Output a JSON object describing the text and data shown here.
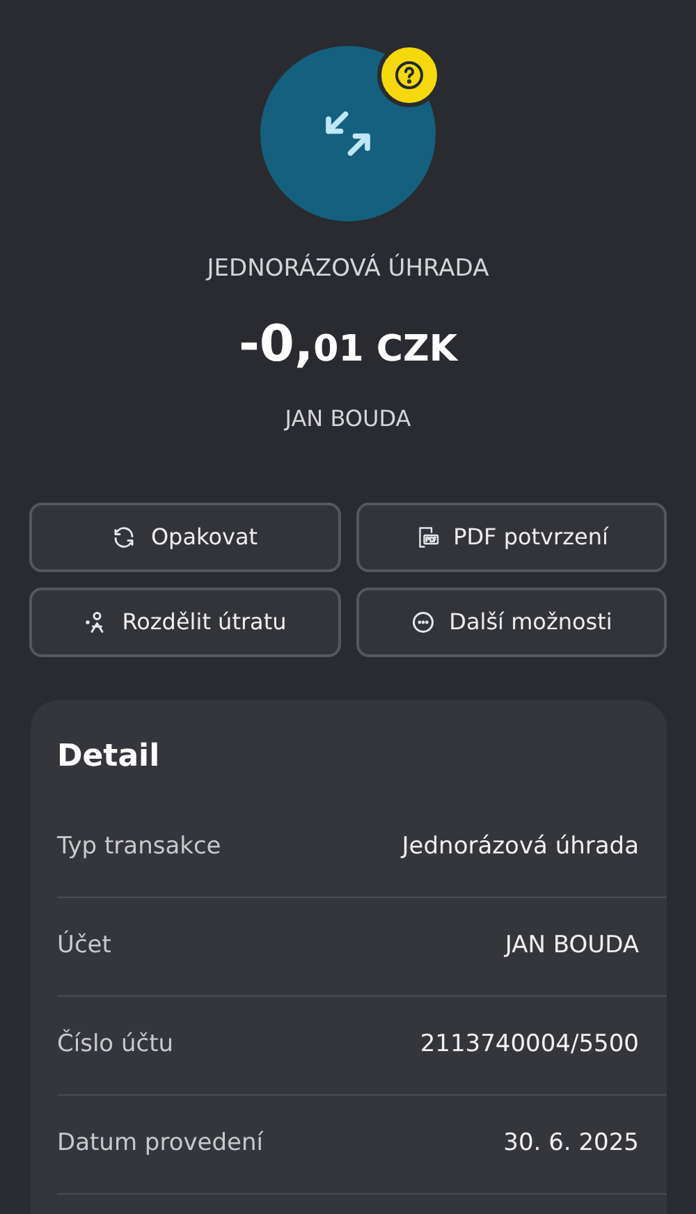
{
  "header": {
    "status_badge": {
      "kind": "question"
    },
    "title": "JEDNORÁZOVÁ ÚHRADA",
    "amount": {
      "whole": "-0,",
      "fraction": "01",
      "currency": "CZK"
    },
    "counterparty": "JAN BOUDA"
  },
  "actions": [
    {
      "kind": "repeat",
      "label": "Opakovat"
    },
    {
      "kind": "pdf",
      "label": "PDF potvrzení"
    },
    {
      "kind": "split",
      "label": "Rozdělit útratu"
    },
    {
      "kind": "more",
      "label": "Další možnosti"
    }
  ],
  "detail": {
    "title": "Detail",
    "rows": [
      {
        "label": "Typ transakce",
        "value": "Jednorázová úhrada"
      },
      {
        "label": "Účet",
        "value": "JAN BOUDA"
      },
      {
        "label": "Číslo účtu",
        "value": "2113740004/5500"
      },
      {
        "label": "Datum provedení",
        "value": "30. 6. 2025"
      }
    ]
  }
}
